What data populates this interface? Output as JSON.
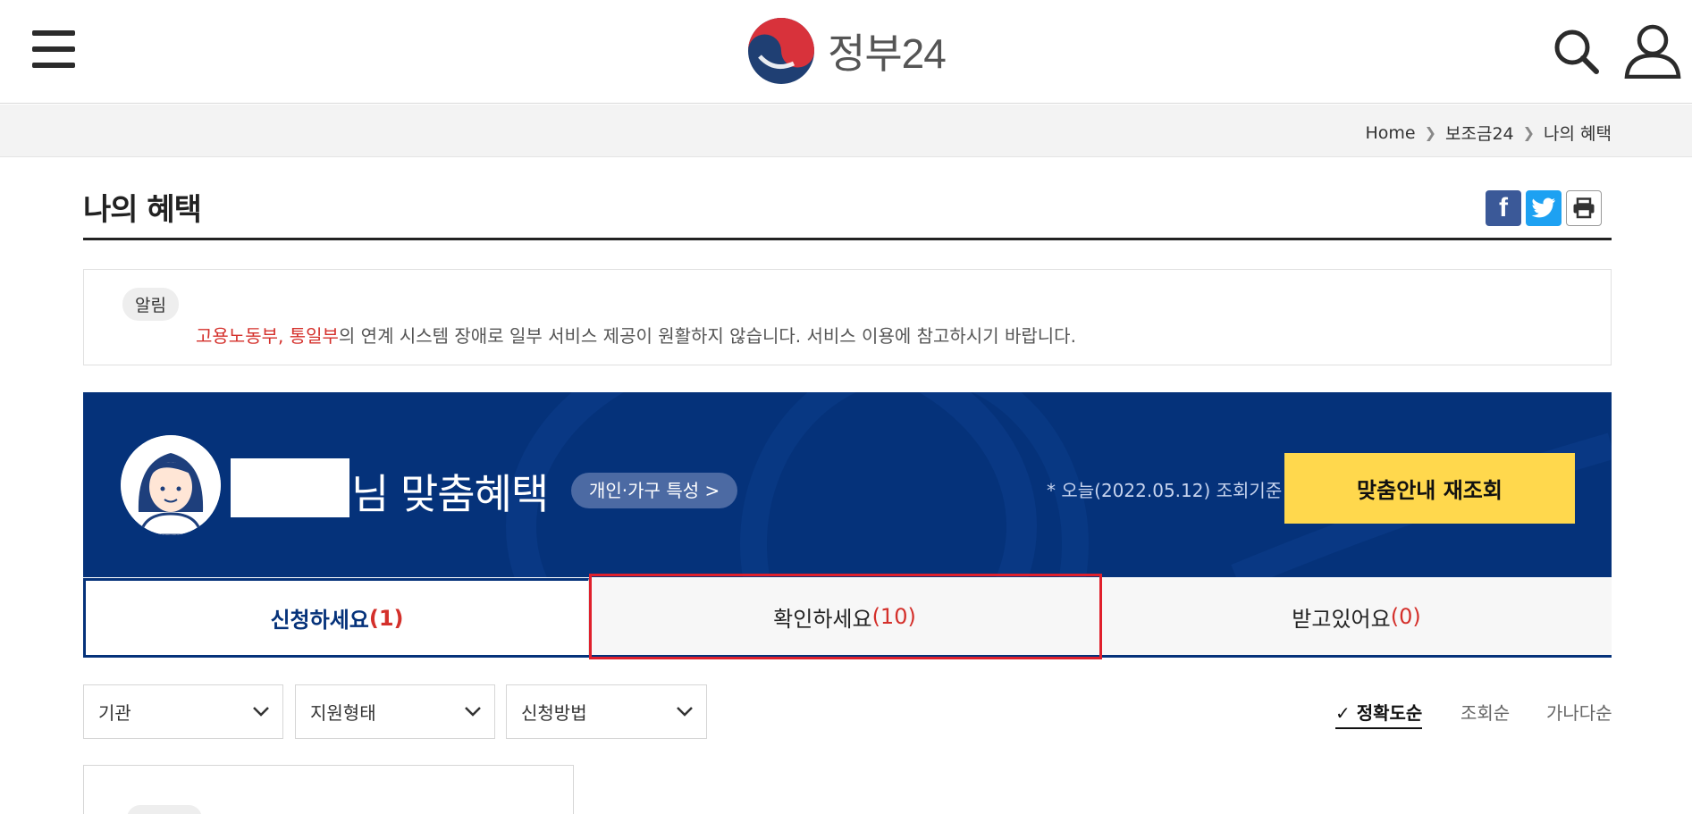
{
  "header": {
    "logo_text": "정부24",
    "menu_icon": "hamburger-menu-icon",
    "search_icon": "search-icon",
    "user_icon": "user-icon"
  },
  "breadcrumb": {
    "items": [
      "Home",
      "보조금24",
      "나의 혜택"
    ]
  },
  "page": {
    "title": "나의 혜택",
    "share": {
      "facebook": "f",
      "twitter_icon": "twitter-icon",
      "print_icon": "print-icon"
    }
  },
  "notice": {
    "badge": "알림",
    "highlight": "고용노동부, 통일부",
    "text": "의 연계 시스템 장애로 일부 서비스 제공이 원활하지 않습니다. 서비스 이용에 참고하시기 바랍니다."
  },
  "hero": {
    "title_suffix": "님 맞춤혜택",
    "trait_button": "개인·가구 특성 >",
    "ref_date": "* 오늘(2022.05.12) 조회기준",
    "requery_button": "맞춤안내 재조회"
  },
  "tabs": [
    {
      "label": "신청하세요",
      "count": "(1)"
    },
    {
      "label": "확인하세요",
      "count": "(10)"
    },
    {
      "label": "받고있어요",
      "count": "(0)"
    }
  ],
  "filters": [
    "기관",
    "지원형태",
    "신청방법"
  ],
  "sort": {
    "options": [
      "정확도순",
      "조회순",
      "가나다순"
    ],
    "check": "✓"
  },
  "colors": {
    "navy": "#05327a",
    "accent_yellow": "#ffd84d",
    "count_red": "#d4302b",
    "highlight_red": "#e0202c"
  }
}
